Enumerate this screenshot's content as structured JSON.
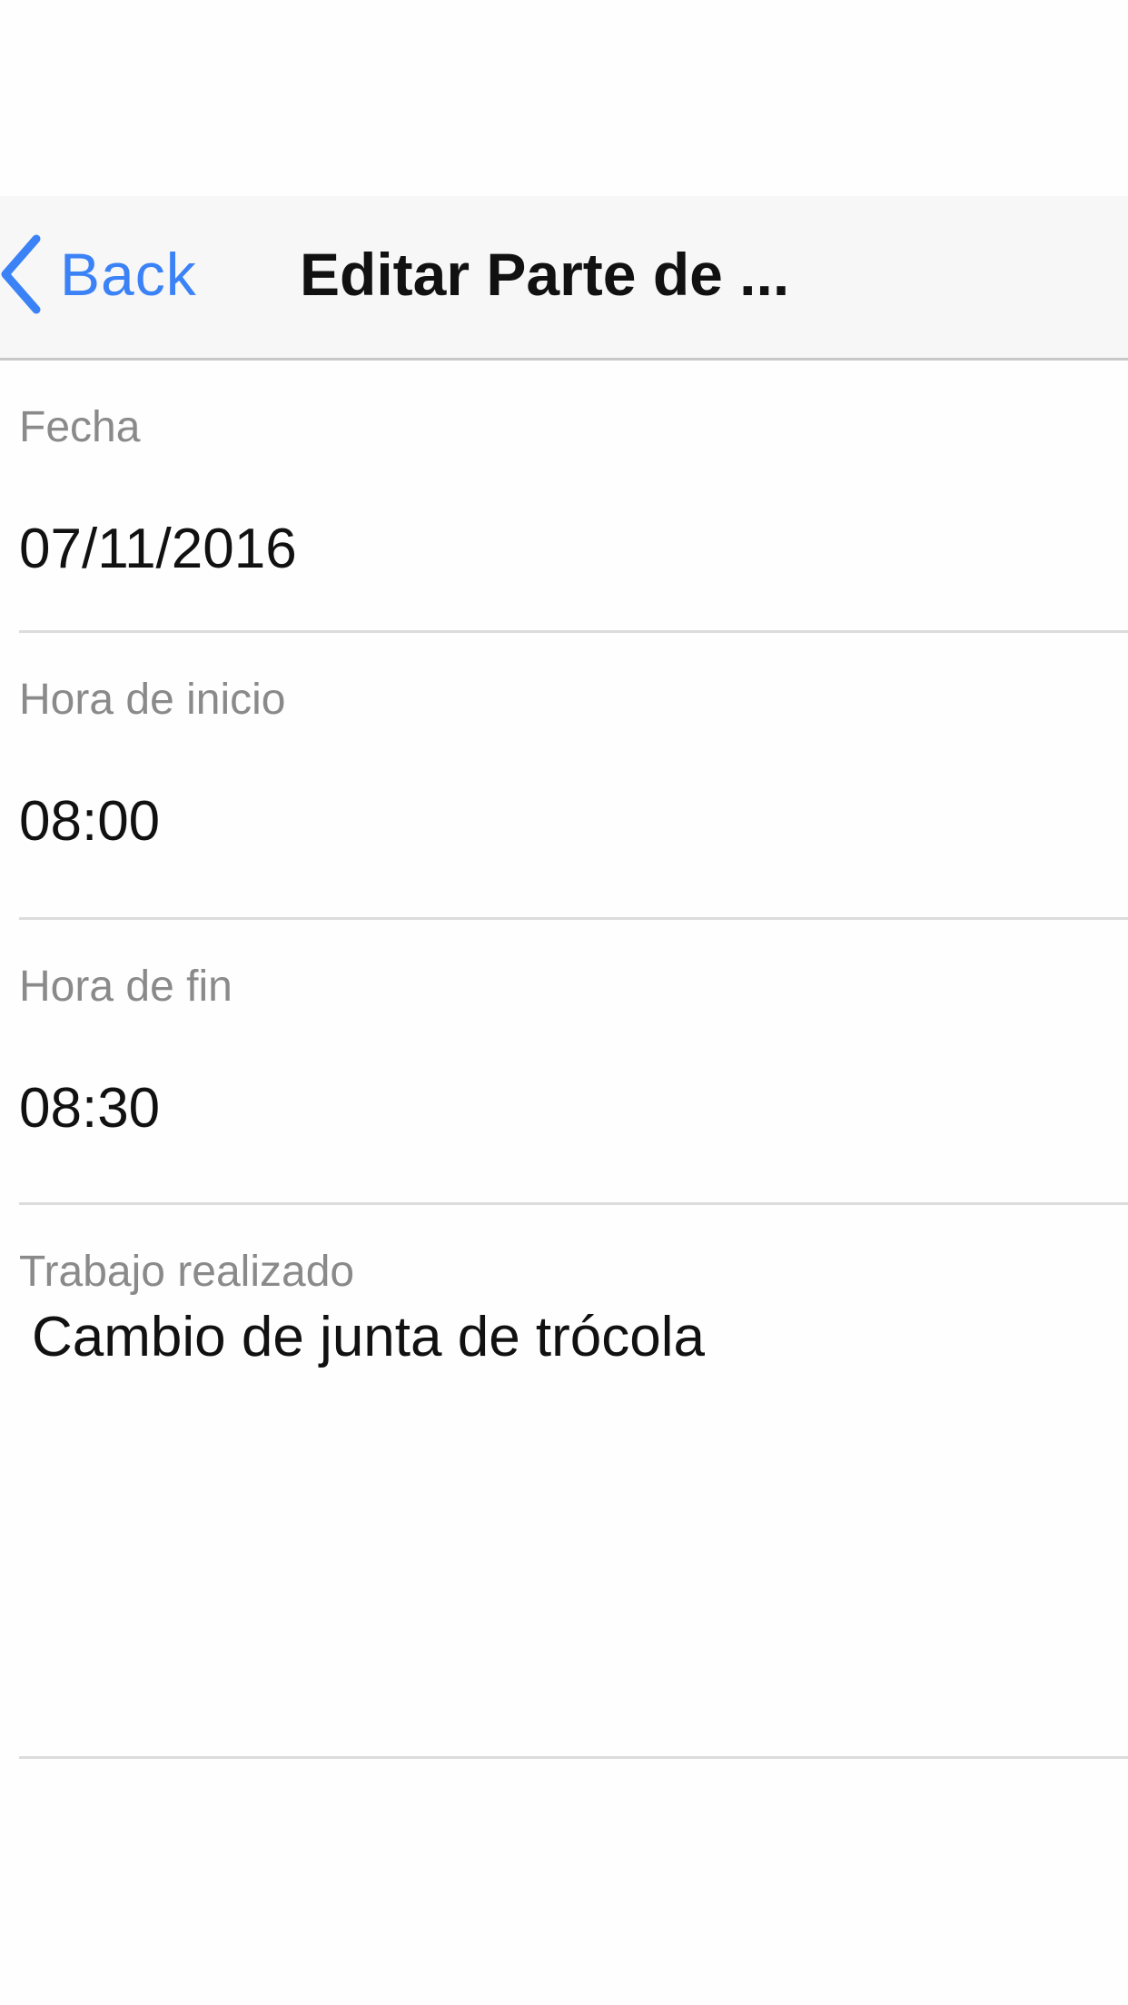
{
  "navbar": {
    "back_label": "Back",
    "title": "Editar Parte de ...",
    "accent_color": "#3b82f6"
  },
  "form": {
    "fecha": {
      "label": "Fecha",
      "value": "07/11/2016"
    },
    "hora_inicio": {
      "label": "Hora de inicio",
      "value": "08:00"
    },
    "hora_fin": {
      "label": "Hora de fin",
      "value": "08:30"
    },
    "trabajo": {
      "label": "Trabajo realizado",
      "value": "Cambio de junta de trócola"
    }
  },
  "icons": {
    "back": "chevron-left-icon"
  }
}
